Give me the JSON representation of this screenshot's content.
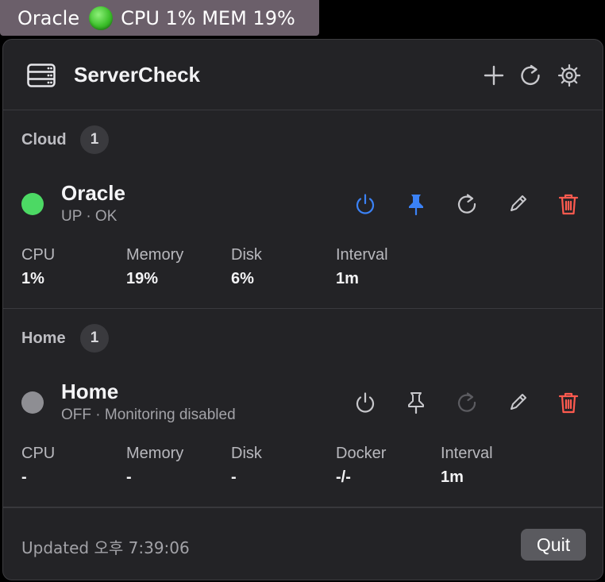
{
  "menubar": {
    "server_name": "Oracle",
    "status_icon": "green-status-dot",
    "stats": "CPU 1% MEM 19%"
  },
  "header": {
    "title": "ServerCheck",
    "icons": [
      "server-rack-icon",
      "plus-icon",
      "refresh-icon",
      "gear-icon"
    ]
  },
  "groups": [
    {
      "label": "Cloud",
      "count": "1",
      "server": {
        "name": "Oracle",
        "status": "UP · OK",
        "status_color": "#4cd964",
        "pinned": true,
        "metrics": [
          {
            "label": "CPU",
            "value": "1%"
          },
          {
            "label": "Memory",
            "value": "19%"
          },
          {
            "label": "Disk",
            "value": "6%"
          },
          {
            "label": "Interval",
            "value": "1m"
          }
        ]
      }
    },
    {
      "label": "Home",
      "count": "1",
      "server": {
        "name": "Home",
        "status": "OFF · Monitoring disabled",
        "status_color": "#8e8e93",
        "pinned": false,
        "metrics": [
          {
            "label": "CPU",
            "value": "-"
          },
          {
            "label": "Memory",
            "value": "-"
          },
          {
            "label": "Disk",
            "value": "-"
          },
          {
            "label": "Docker",
            "value": "-/-"
          },
          {
            "label": "Interval",
            "value": "1m"
          }
        ]
      }
    }
  ],
  "footer": {
    "updated": "Updated 오후 7:39:06",
    "quit_label": "Quit"
  },
  "colors": {
    "accent_blue": "#3b82f6",
    "delete_red": "#ff5a4f",
    "up_green": "#4cd964",
    "off_gray": "#8e8e93"
  }
}
